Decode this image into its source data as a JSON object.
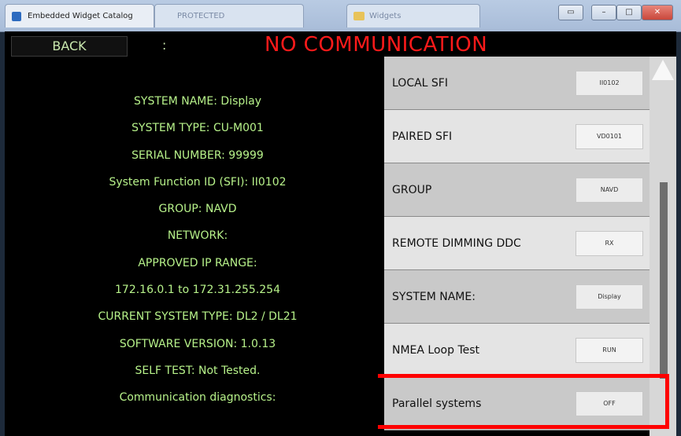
{
  "window": {
    "tabs": [
      {
        "label": "Embedded Widget Catalog"
      },
      {
        "label": "PROTECTED"
      },
      {
        "label": "Widgets"
      }
    ]
  },
  "topbar": {
    "back_label": "BACK",
    "separator": ":",
    "status": "NO COMMUNICATION",
    "status_color": "#ff1a1a"
  },
  "info_lines": [
    "SYSTEM NAME: Display",
    "SYSTEM TYPE: CU-M001",
    "SERIAL NUMBER: 99999",
    "System Function ID (SFI): II0102",
    "GROUP: NAVD",
    "NETWORK:",
    "APPROVED IP RANGE:",
    "172.16.0.1 to 172.31.255.254",
    "CURRENT SYSTEM TYPE: DL2 / DL21",
    "SOFTWARE VERSION: 1.0.13",
    "SELF TEST: Not Tested.",
    "Communication diagnostics:"
  ],
  "settings": [
    {
      "label": "LOCAL SFI",
      "value": "II0102"
    },
    {
      "label": "PAIRED SFI",
      "value": "VD0101"
    },
    {
      "label": "GROUP",
      "value": "NAVD"
    },
    {
      "label": "REMOTE DIMMING DDC",
      "value": "RX"
    },
    {
      "label": "SYSTEM NAME:",
      "value": "Display"
    },
    {
      "label": "NMEA Loop Test",
      "value": "RUN"
    },
    {
      "label": "Parallel systems",
      "value": "OFF"
    }
  ],
  "colors": {
    "info_text": "#b7f28a",
    "highlight": "#ff0000"
  }
}
